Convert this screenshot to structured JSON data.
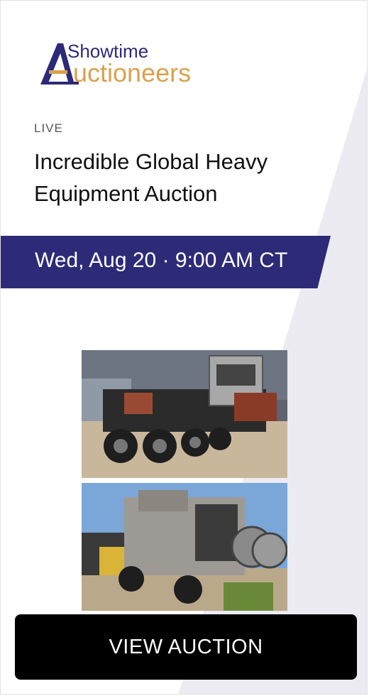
{
  "brand": {
    "logo_top_text": "Showtime",
    "logo_bottom_text": "uctioneers",
    "logo_letter": "A",
    "colors": {
      "navy": "#2d2a78",
      "gold": "#d9a14e"
    }
  },
  "auction": {
    "status": "LIVE",
    "title": "Incredible Global Heavy Equipment Auction",
    "date": "Wed, Aug 20 · 9:00 AM CT"
  },
  "photos": [
    {
      "description_icon": "heavy-equipment-trailer-photo"
    },
    {
      "description_icon": "frac-equipment-trailer-photo"
    }
  ],
  "cta": {
    "label": "VIEW AUCTION"
  },
  "colors": {
    "banner": "#2d2a78",
    "button": "#000000",
    "background_shape": "#ecebf2"
  }
}
